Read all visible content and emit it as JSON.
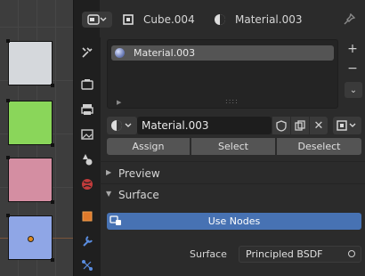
{
  "header": {
    "object_name": "Cube.004",
    "material_name": "Material.003"
  },
  "material_slots": {
    "items": [
      {
        "label": "Material.003",
        "selected": true
      }
    ]
  },
  "datablock": {
    "name": "Material.003"
  },
  "slot_actions": {
    "assign": "Assign",
    "select": "Select",
    "deselect": "Deselect"
  },
  "panels": {
    "preview": "Preview",
    "surface": "Surface"
  },
  "use_nodes": "Use Nodes",
  "surface_field": {
    "label": "Surface",
    "value": "Principled BSDF"
  },
  "viewport_swatches": [
    {
      "color": "#d5d8dc"
    },
    {
      "color": "#8ad65a"
    },
    {
      "color": "#d48ea2"
    },
    {
      "color": "#8fa6e6"
    }
  ],
  "colors": {
    "accent_blue": "#4772b3",
    "active_material_tab": "#e06a2b"
  }
}
